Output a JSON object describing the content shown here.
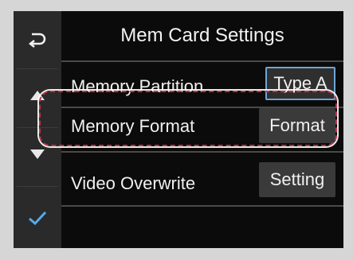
{
  "header": {
    "title": "Mem Card Settings"
  },
  "side": {
    "back_icon": "back-arrow-icon",
    "up_icon": "triangle-up-icon",
    "down_icon": "triangle-down-icon",
    "confirm_icon": "checkmark-icon"
  },
  "rows": [
    {
      "label": "Memory Partition",
      "button": "Type A"
    },
    {
      "label": "Memory Format",
      "button": "Format"
    },
    {
      "label": "Video Overwrite",
      "button": "Setting"
    }
  ],
  "colors": {
    "accent": "#6ea6d4",
    "highlight": "#c0304a",
    "check": "#58a9e6"
  }
}
